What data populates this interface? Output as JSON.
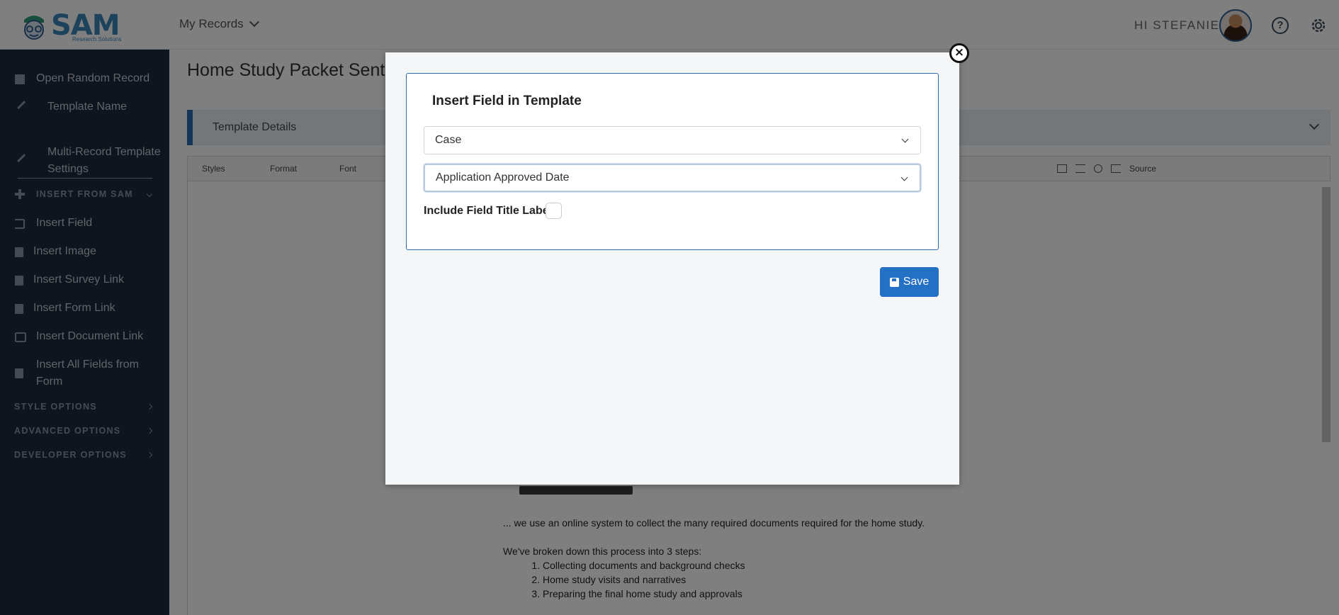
{
  "header": {
    "logo_text": "SAM",
    "logo_subtext": "Research Solutions",
    "records_menu_label": "My Records",
    "greeting": "HI STEFANIE"
  },
  "sidebar": {
    "items": [
      {
        "label": "Open Random Record",
        "icon": "document-icon"
      },
      {
        "label": "Template Name",
        "icon": "pencil-icon"
      },
      {
        "label": "Multi-Record Template Settings",
        "icon": "pencil-icon"
      },
      {
        "label": "Insert Field",
        "icon": "sign-in-icon"
      },
      {
        "label": "Insert Image",
        "icon": "file-image-icon"
      },
      {
        "label": "Insert Survey Link",
        "icon": "clipboard-icon"
      },
      {
        "label": "Insert Form Link",
        "icon": "file-edit-icon"
      },
      {
        "label": "Insert Document Link",
        "icon": "folder-open-icon"
      },
      {
        "label": "Insert All Fields from Form",
        "icon": "file-edit-icon"
      }
    ],
    "sections": {
      "insert_from_sam": "INSERT FROM SAM",
      "style_options": "STYLE OPTIONS",
      "advanced_options": "ADVANCED OPTIONS",
      "developer_options": "DEVELOPER OPTIONS"
    }
  },
  "main": {
    "title": "Home Study Packet Sent |",
    "details_label": "Template Details",
    "toolbar": {
      "styles": "Styles",
      "format": "Format",
      "font": "Font",
      "source": "Source"
    },
    "document": {
      "paragraph1": "... we use an online system to collect the many required documents required for the home study.",
      "paragraph2": "We've broken down this process into 3 steps:",
      "steps": [
        "Collecting documents and background checks",
        "Home study visits and narratives",
        "Preparing the final home study and approvals"
      ]
    }
  },
  "modal": {
    "title": "Insert Field in Template",
    "select_form_value": "Case",
    "select_field_value": "Application Approved Date",
    "include_label": "Include Field Title Label",
    "include_checked": false,
    "save_label": "Save",
    "close_glyph": "×"
  }
}
